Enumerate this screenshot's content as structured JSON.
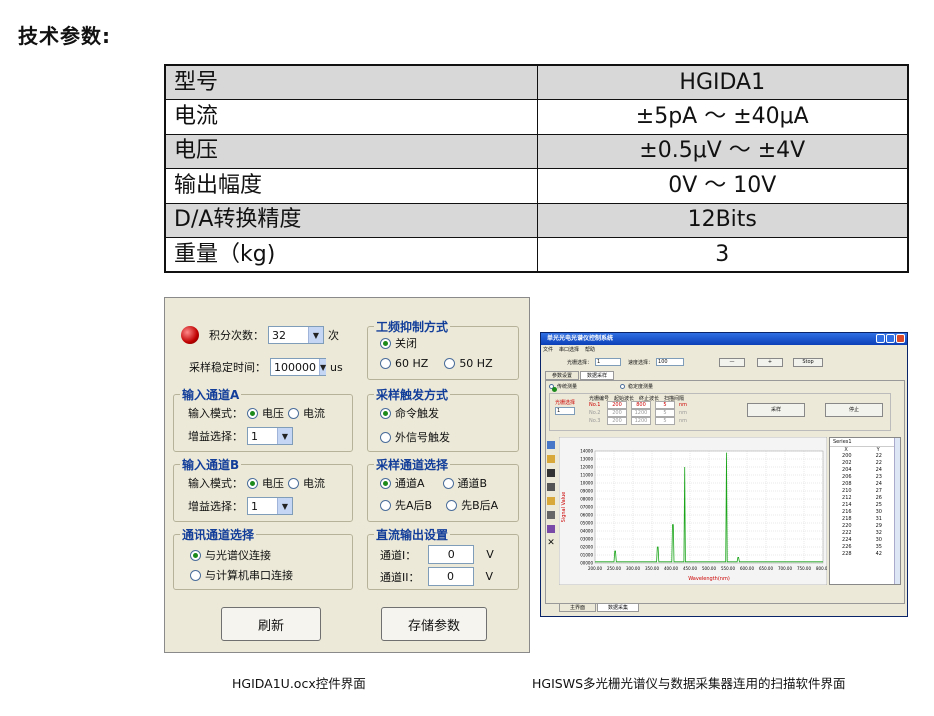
{
  "heading": "技术参数:",
  "spec_rows": [
    {
      "key": "型号",
      "value": "HGIDA1"
    },
    {
      "key": "电流",
      "value": "±5pA ～ ±40μA"
    },
    {
      "key": "电压",
      "value": "±0.5μV ～ ±4V"
    },
    {
      "key": "输出幅度",
      "value": "0V ～ 10V"
    },
    {
      "key": "D/A转换精度",
      "value": "12Bits"
    },
    {
      "key": "重量（kg)",
      "value": "3"
    }
  ],
  "left_panel": {
    "integration_label": "积分次数：",
    "integration_value": "32",
    "integration_unit": "次",
    "settle_label": "采样稳定时间：",
    "settle_value": "100000",
    "settle_unit": "us",
    "input_a": {
      "title": "输入通道A",
      "mode_label": "输入模式：",
      "opt_voltage": "电压",
      "opt_current": "电流",
      "gain_label": "增益选择：",
      "gain_value": "1"
    },
    "input_b": {
      "title": "输入通道B",
      "mode_label": "输入模式：",
      "opt_voltage": "电压",
      "opt_current": "电流",
      "gain_label": "增益选择：",
      "gain_value": "1"
    },
    "comm": {
      "title": "通讯通道选择",
      "opt1": "与光谱仪连接",
      "opt2": "与计算机串口连接"
    },
    "power_freq": {
      "title": "工频抑制方式",
      "off": "关闭",
      "hz60": "60 HZ",
      "hz50": "50 HZ"
    },
    "trigger": {
      "title": "采样触发方式",
      "cmd": "命令触发",
      "ext": "外信号触发"
    },
    "channel_sel": {
      "title": "采样通道选择",
      "a": "通道A",
      "b": "通道B",
      "ab": "先A后B",
      "ba": "先B后A"
    },
    "dc_out": {
      "title": "直流输出设置",
      "ch1": "通道I：",
      "ch2": "通道II：",
      "val1": "0",
      "val2": "0",
      "unit": "V"
    },
    "refresh": "刷新",
    "save": "存储参数"
  },
  "right_app": {
    "title": "单光光电光谱仪控制系统",
    "menu": [
      "文件",
      "串口选择",
      "帮助"
    ],
    "grating_label": "光栅选择：",
    "grating_value": "1",
    "speed_label": "速度选择：",
    "speed_value": "100",
    "btn_minus": "—",
    "btn_plus": "+",
    "btn_stop": "Stop",
    "tabs": [
      "参数设置",
      "数据采样"
    ],
    "mode_wave": "传统测量",
    "mode_fixed": "稳定度测量",
    "grating_sel": "光栅选择",
    "col_grating_no": "光栅编号",
    "col_start": "起始波长",
    "col_end": "终止波长",
    "col_step": "扫描间隔",
    "rows": [
      {
        "no": "No.1",
        "start": "200",
        "end": "800",
        "step": "5",
        "unit": "nm"
      },
      {
        "no": "No.2",
        "start": "200",
        "end": "1200",
        "step": "5",
        "unit": "nm"
      },
      {
        "no": "No.3",
        "start": "200",
        "end": "1200",
        "step": "5",
        "unit": "nm"
      }
    ],
    "btn_sample": "采样",
    "btn_halt": "停止",
    "y_label": "Signal Value",
    "x_label": "Wavelength(nm)",
    "y_ticks": [
      "14000",
      "13000",
      "12000",
      "11000",
      "10000",
      "09000",
      "08000",
      "07000",
      "06000",
      "05000",
      "04000",
      "03000",
      "02000",
      "01000",
      "00000"
    ],
    "x_ticks": [
      "200.00",
      "250.00",
      "300.00",
      "350.00",
      "400.00",
      "450.00",
      "500.00",
      "550.00",
      "600.00",
      "650.00",
      "700.00",
      "750.00",
      "800.00"
    ],
    "list_title": "Series1",
    "list_headers": [
      "X",
      "Y"
    ],
    "list_rows": [
      [
        "200",
        "22"
      ],
      [
        "202",
        "22"
      ],
      [
        "204",
        "24"
      ],
      [
        "206",
        "23"
      ],
      [
        "208",
        "24"
      ],
      [
        "210",
        "27"
      ],
      [
        "212",
        "26"
      ],
      [
        "214",
        "25"
      ],
      [
        "216",
        "30"
      ],
      [
        "218",
        "31"
      ],
      [
        "220",
        "29"
      ],
      [
        "222",
        "32"
      ],
      [
        "224",
        "30"
      ],
      [
        "226",
        "35"
      ],
      [
        "228",
        "42"
      ]
    ],
    "bottom_tabs": [
      "主界面",
      "数据采集"
    ]
  },
  "captions": {
    "left": "HGIDA1U.ocx控件界面",
    "right": "HGISWS多光栅光谱仪与数据采集器连用的扫描软件界面"
  }
}
